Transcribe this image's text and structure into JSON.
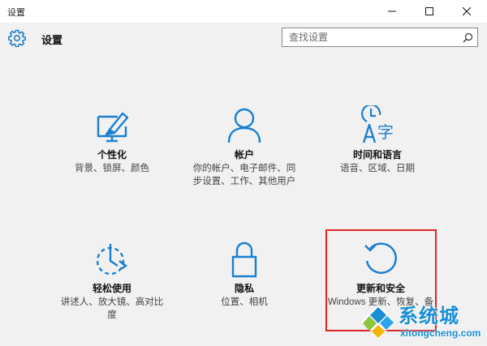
{
  "window": {
    "title": "设置"
  },
  "header": {
    "title": "设置"
  },
  "search": {
    "placeholder": "查找设置"
  },
  "tiles": [
    {
      "label": "个性化",
      "description": "背景、锁屏、颜色",
      "icon": "personalization-icon"
    },
    {
      "label": "帐户",
      "description": "你的帐户、电子邮件、同步设置、工作、其他用户",
      "icon": "account-icon"
    },
    {
      "label": "时间和语言",
      "description": "语音、区域、日期",
      "icon": "time-language-icon"
    },
    {
      "label": "轻松使用",
      "description": "讲述人、放大镜、高对比度",
      "icon": "ease-of-access-icon"
    },
    {
      "label": "隐私",
      "description": "位置、相机",
      "icon": "privacy-lock-icon"
    },
    {
      "label": "更新和安全",
      "description": "Windows 更新、恢复、备份",
      "icon": "update-security-icon"
    }
  ],
  "watermark": {
    "brand": "系统城",
    "url": "xitongcheng.com"
  },
  "colors": {
    "accent": "#1a7fd0",
    "highlight": "#e02424",
    "background": "#f1f1f1"
  }
}
